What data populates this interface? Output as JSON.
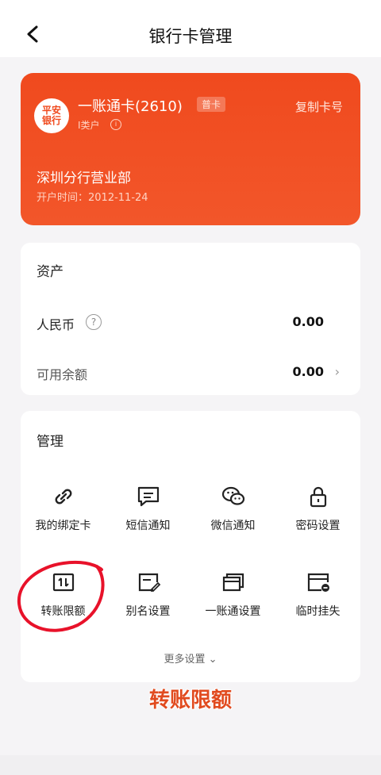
{
  "header": {
    "title": "银行卡管理"
  },
  "card": {
    "logo_text": "平安\n银行",
    "name": "一账通卡(2610)",
    "type_badge": "普卡",
    "class_label": "I类户",
    "copy_label": "复制卡号",
    "branch": "深圳分行营业部",
    "open_date": "开户时间：2012-11-24",
    "colors": {
      "card_bg": "#f04a1e"
    }
  },
  "assets": {
    "title": "资产",
    "rmb_label": "人民币",
    "rmb_value": "0.00",
    "available_label": "可用余额",
    "available_value": "0.00"
  },
  "manage": {
    "title": "管理",
    "items": [
      {
        "label": "我的绑定卡",
        "icon": "link-icon"
      },
      {
        "label": "短信通知",
        "icon": "message-icon"
      },
      {
        "label": "微信通知",
        "icon": "wechat-icon"
      },
      {
        "label": "密码设置",
        "icon": "lock-icon"
      },
      {
        "label": "转账限额",
        "icon": "transfer-limit-icon"
      },
      {
        "label": "别名设置",
        "icon": "edit-card-icon"
      },
      {
        "label": "一账通设置",
        "icon": "cards-icon"
      },
      {
        "label": "临时挂失",
        "icon": "card-suspend-icon"
      }
    ],
    "more_label": "更多设置"
  },
  "overlay": {
    "caption": "转账限额",
    "accent_color": "#e8122a"
  }
}
